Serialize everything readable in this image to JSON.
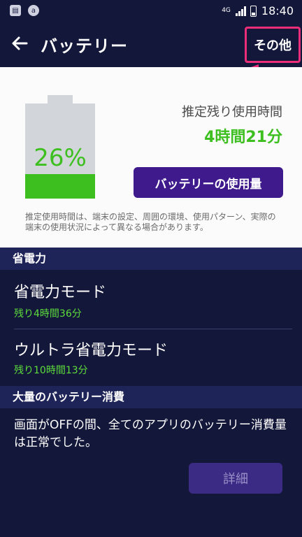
{
  "status_bar": {
    "network": "4G",
    "time": "18:40",
    "left_icons": [
      "notification-icon",
      "a-icon"
    ]
  },
  "app_bar": {
    "title": "バッテリー",
    "back_icon": "back-arrow-icon",
    "more_label": "その他"
  },
  "battery_card": {
    "percent_text": "26%",
    "percent_value": 26,
    "remaining_label": "推定残り使用時間",
    "remaining_time": "4時間21分",
    "usage_button": "バッテリーの使用量",
    "note": "推定使用時間は、端末の設定、周囲の環境、使用パターン、実際の端末の使用状況によって異なる場合があります。"
  },
  "power_saving": {
    "header": "省電力",
    "items": [
      {
        "title": "省電力モード",
        "subtitle": "残り4時間36分"
      },
      {
        "title": "ウルトラ省電力モード",
        "subtitle": "残り10時間13分"
      }
    ]
  },
  "heavy_usage": {
    "header": "大量のバッテリー消費",
    "message": "画面がOFFの間、全てのアプリのバッテリー消費量は正常でした。",
    "details_button": "詳細"
  },
  "colors": {
    "background": "#13173a",
    "accent_green": "#3cbf1f",
    "button_purple": "#3e1a8c",
    "highlight_pink": "#ec2d7a"
  }
}
